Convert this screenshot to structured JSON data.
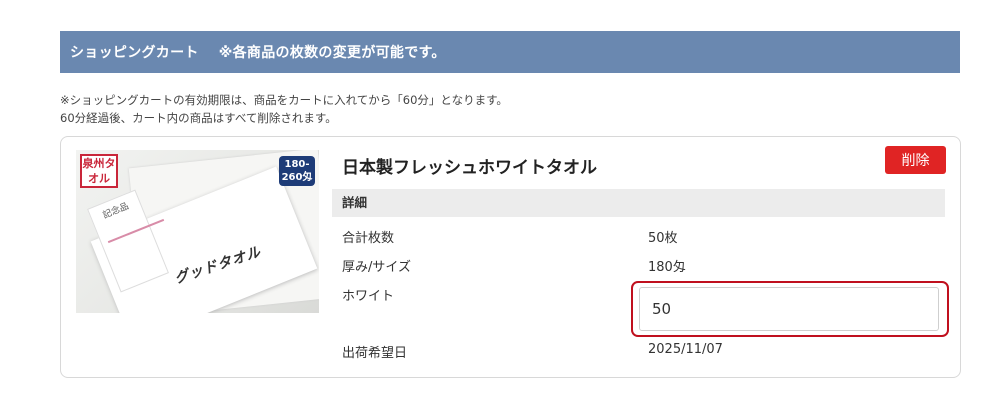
{
  "cart": {
    "title": "ショッピングカート",
    "subtitle": "※各商品の枚数の変更が可能です。",
    "notice_line1": "※ショッピングカートの有効期限は、商品をカートに入れてから「60分」となります。",
    "notice_line2": "60分経過後、カート内の商品はすべて削除されます。"
  },
  "item": {
    "name": "日本製フレッシュホワイトタオル",
    "delete_label": "削除",
    "details_label": "詳細",
    "image": {
      "logo_text": "泉州タオル",
      "weight_badge_line1": "180-",
      "weight_badge_line2": "260匁",
      "noshi_text": "記念品",
      "print_text": "グッドタオル"
    },
    "rows": [
      {
        "label": "合計枚数",
        "value": "50枚"
      },
      {
        "label": "厚み/サイズ",
        "value": "180匁"
      },
      {
        "label": "ホワイト",
        "value": ""
      },
      {
        "label": "出荷希望日",
        "value": "2025/11/07"
      }
    ],
    "quantity_value": "50"
  }
}
